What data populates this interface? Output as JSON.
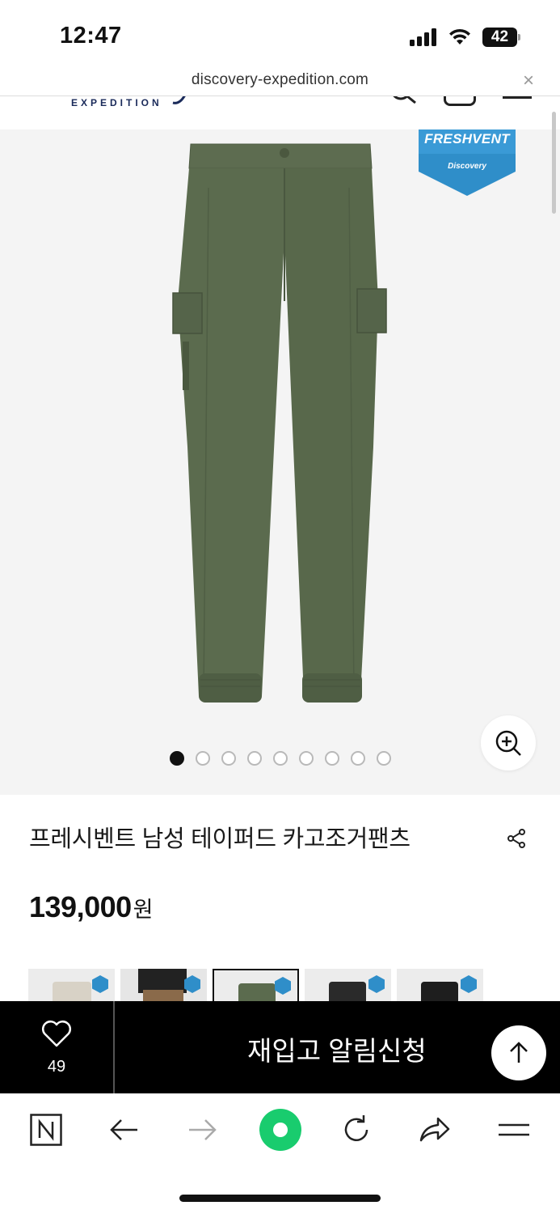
{
  "status_bar": {
    "time": "12:47",
    "battery": "42",
    "icons": [
      "cellular-signal-icon",
      "wifi-icon",
      "battery-icon"
    ]
  },
  "browser": {
    "url": "discovery-expedition.com",
    "close_glyph": "×"
  },
  "site_header": {
    "logo_text": "EXPEDITION",
    "icons": [
      "search-icon",
      "shopping-bag-icon",
      "menu-icon"
    ]
  },
  "product": {
    "badge_title": "FRESHVENT",
    "badge_brand": "Discovery",
    "image_dots_total": 9,
    "image_dots_active_index": 0,
    "name": "프레시벤트 남성 테이퍼드 카고조거팬츠",
    "price": "139,000",
    "price_unit": "원",
    "product_color": "#5b6b4e"
  },
  "color_swatches": [
    {
      "name": "beige",
      "color": "#d8d2c6"
    },
    {
      "name": "brown",
      "color": "#8a6a4a"
    },
    {
      "name": "khaki",
      "color": "#5b6b4e",
      "selected": true
    },
    {
      "name": "black",
      "color": "#2a2a2a"
    },
    {
      "name": "black-2",
      "color": "#1e1e1e"
    }
  ],
  "action_bar": {
    "like_count": "49",
    "restock_label": "재입고 알림신청"
  },
  "toolbar": {
    "items": [
      "naver-n-icon",
      "back-arrow-icon",
      "forward-arrow-icon",
      "green-dot-icon",
      "refresh-icon",
      "share-icon",
      "menu-icon"
    ]
  },
  "colors": {
    "accent_green": "#19cc6e",
    "action_bar_bg": "#000000",
    "badge_blue": "#2f8ec9"
  }
}
